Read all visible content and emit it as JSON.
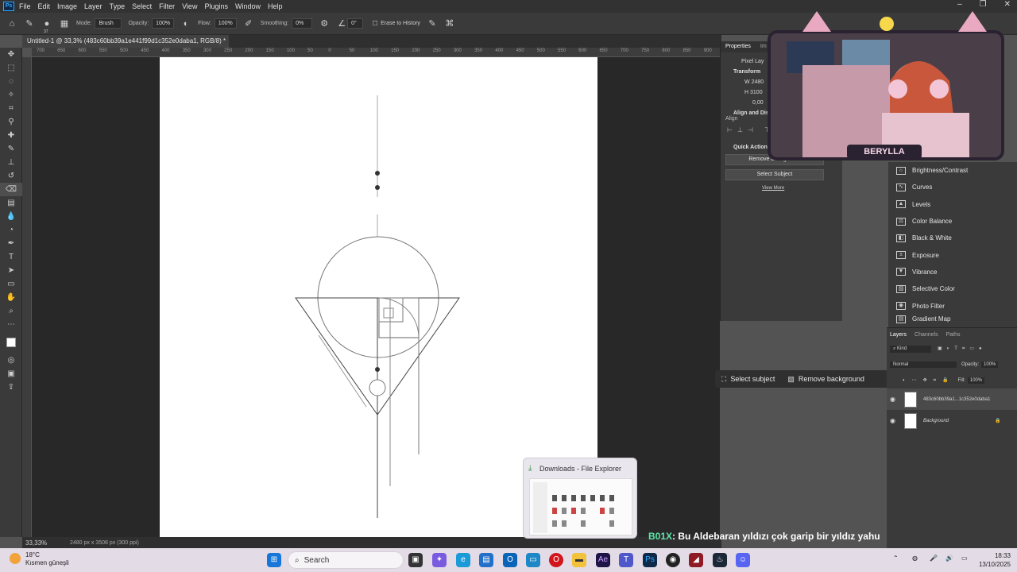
{
  "menu": {
    "items": [
      "File",
      "Edit",
      "Image",
      "Layer",
      "Type",
      "Select",
      "Filter",
      "View",
      "Plugins",
      "Window",
      "Help"
    ]
  },
  "options_bar": {
    "brush_size": "37",
    "mode_label": "Mode:",
    "mode_value": "Brush",
    "opacity_label": "Opacity:",
    "opacity_value": "100%",
    "flow_label": "Flow:",
    "flow_value": "100%",
    "smoothing_label": "Smoothing:",
    "smoothing_value": "0%",
    "angle_value": "0°",
    "erase_history_label": "Erase to History"
  },
  "document": {
    "tab_title": "Untitled-1 @ 33,3% (483c60bb39a1e441f99d1c352e0daba1, RGB/8) *",
    "ruler_ticks": [
      "700",
      "650",
      "600",
      "550",
      "500",
      "450",
      "400",
      "350",
      "300",
      "250",
      "200",
      "150",
      "100",
      "50",
      "0",
      "50",
      "100",
      "150",
      "200",
      "250",
      "300",
      "350",
      "400",
      "450",
      "500",
      "550",
      "600",
      "650",
      "700",
      "750",
      "800",
      "850",
      "900"
    ],
    "zoom": "33,33%",
    "dimensions": "2480 px x 3508 px (300 ppi)"
  },
  "properties": {
    "tabs": [
      "Properties",
      "Im"
    ],
    "pixel_layer": "Pixel Lay",
    "transform_title": "Transform",
    "w_label": "W",
    "w_value": "2480",
    "h_label": "H",
    "h_value": "3100",
    "angle_value": "0,00",
    "align_title": "Align and Dis",
    "align_sub": "Align",
    "quick_actions_title": "Quick Actions",
    "remove_bg_button": "Remove Background",
    "select_subject_button": "Select Subject",
    "view_more": "View More"
  },
  "adjustments": {
    "items": [
      "Brightness/Contrast",
      "Curves",
      "Levels",
      "Color Balance",
      "Black & White",
      "Exposure",
      "Vibrance",
      "Selective Color",
      "Photo Filter",
      "Gradient Map"
    ]
  },
  "layers": {
    "tabs": [
      "Layers",
      "Channels",
      "Paths"
    ],
    "filter_label": "Kind",
    "blend_mode": "Normal",
    "opacity_label": "Opacity:",
    "opacity_value": "100%",
    "fill_label": "Fill:",
    "fill_value": "100%",
    "list": [
      {
        "name": "483c60bb39a1...1c352e0daba1"
      },
      {
        "name": "Background"
      }
    ]
  },
  "context_bar": {
    "select_subject": "Select subject",
    "remove_background": "Remove background"
  },
  "webcam": {
    "streamer_name": "BERYLLA"
  },
  "chat": {
    "user": "B01X",
    "message": ": Bu Aldebaran yıldızı çok garip bir yıldız yahu"
  },
  "explorer_preview": {
    "title": "Downloads - File Explorer"
  },
  "taskbar": {
    "weather_temp": "18°C",
    "weather_desc": "Kısmen güneşli",
    "search_placeholder": "Search",
    "time": "18:33",
    "date": "13/10/2025"
  },
  "colors": {
    "ps_accent": "#31a8ff",
    "canvas_bg": "#ffffff",
    "workspace_bg": "#282828",
    "panel_bg": "#3a3a3a",
    "chat_user_color": "#5be7a9",
    "taskbar_bg": "#e3dbe6"
  }
}
